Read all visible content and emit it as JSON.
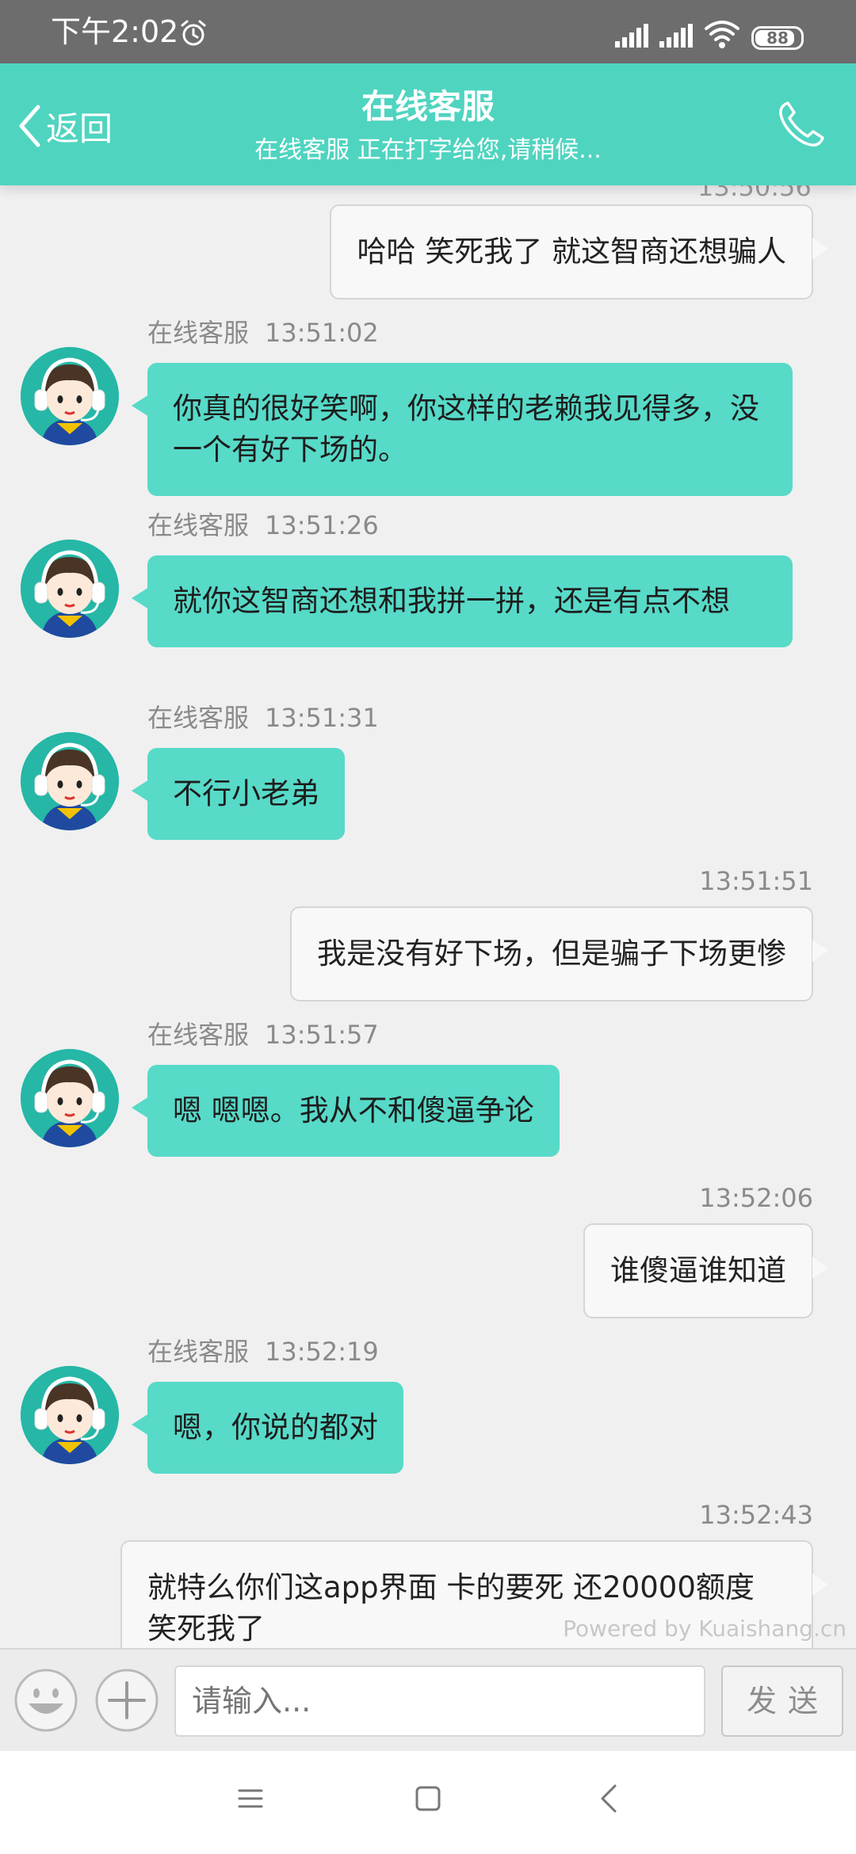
{
  "status_bar": {
    "time": "下午2:02",
    "battery": "88",
    "battery_level": 0.88
  },
  "header": {
    "back_label": "返回",
    "title": "在线客服",
    "subtitle": "在线客服 正在打字给您,请稍候..."
  },
  "chat": {
    "clipped_time": "13:50:56",
    "messages": [
      {
        "side": "user",
        "text": "哈哈 笑死我了 就这智商还想骗人"
      },
      {
        "side": "agent",
        "sender": "在线客服",
        "time": "13:51:02",
        "text": "你真的很好笑啊，你这样的老赖我见得多，没一个有好下场的。"
      },
      {
        "side": "agent",
        "sender": "在线客服",
        "time": "13:51:26",
        "text": "就你这智商还想和我拼一拼，还是有点不想"
      },
      {
        "side": "agent",
        "sender": "在线客服",
        "time": "13:51:31",
        "text": "不行小老弟"
      },
      {
        "side": "user",
        "time": "13:51:51",
        "text": "我是没有好下场，但是骗子下场更惨"
      },
      {
        "side": "agent",
        "sender": "在线客服",
        "time": "13:51:57",
        "text": "嗯 嗯嗯。我从不和傻逼争论"
      },
      {
        "side": "user",
        "time": "13:52:06",
        "text": "谁傻逼谁知道"
      },
      {
        "side": "agent",
        "sender": "在线客服",
        "time": "13:52:19",
        "text": "嗯，你说的都对"
      },
      {
        "side": "user",
        "time": "13:52:43",
        "text": "就特么你们这app界面 卡的要死 还20000额度 笑死我了"
      }
    ],
    "powered_by": "Powered by Kuaishang.cn"
  },
  "input_bar": {
    "placeholder": "请输入...",
    "send_label": "发送"
  },
  "colors": {
    "accent": "#4fd4c0",
    "agent_bubble": "#57dac8",
    "user_bubble": "#f8f8f8",
    "status_bar": "#6d6d6d"
  },
  "icons": [
    "alarm-icon",
    "signal-icon",
    "wifi-icon",
    "battery-icon",
    "back-chevron-icon",
    "phone-icon",
    "emoji-icon",
    "plus-icon",
    "menu-icon",
    "home-icon",
    "nav-back-icon"
  ]
}
